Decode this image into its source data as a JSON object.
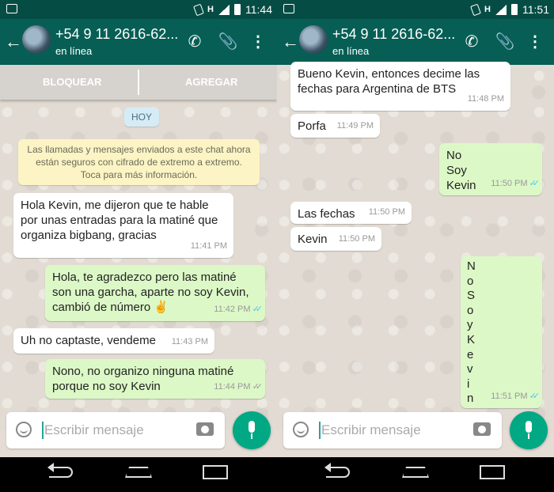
{
  "status": {
    "left_time": "11:44",
    "right_time": "11:51",
    "network": "H"
  },
  "contact": {
    "name": "+54 9 11 2616-62...",
    "status": "en línea"
  },
  "actions": {
    "block": "BLOQUEAR",
    "add": "AGREGAR"
  },
  "chip": "HOY",
  "notice": "Las llamadas y mensajes enviados a este chat ahora están seguros con cifrado de extremo a extremo. Toca para más información.",
  "left_messages": [
    {
      "dir": "in",
      "text": "Hola Kevin, me dijeron que te hable por unas entradas para la matiné que organiza bigbang, gracias",
      "time": "11:41 PM",
      "ticks": ""
    },
    {
      "dir": "out",
      "text": "Hola, te agradezco pero las matiné son una garcha, aparte no soy Kevin, cambió de número ✌",
      "time": "11:42 PM",
      "ticks": "read"
    },
    {
      "dir": "in",
      "text": "Uh no captaste, vendeme",
      "time": "11:43 PM",
      "ticks": ""
    },
    {
      "dir": "out",
      "text": "Nono, no organizo ninguna matiné porque no soy Kevin",
      "time": "11:44 PM",
      "ticks": "delivered"
    }
  ],
  "right_messages": [
    {
      "dir": "in",
      "text": "Bueno Kevin, entonces decime las fechas para Argentina de BTS",
      "time": "11:48 PM",
      "ticks": ""
    },
    {
      "dir": "in",
      "text": "Porfa",
      "time": "11:49 PM",
      "ticks": ""
    },
    {
      "dir": "out",
      "text": "No Soy Kevin",
      "time": "11:50 PM",
      "ticks": "read"
    },
    {
      "dir": "in",
      "text": "Las fechas",
      "time": "11:50 PM",
      "ticks": ""
    },
    {
      "dir": "in",
      "text": "Kevin",
      "time": "11:50 PM",
      "ticks": ""
    },
    {
      "dir": "out",
      "text": "N o S o y K e v i n",
      "time": "11:51 PM",
      "ticks": "read"
    }
  ],
  "input": {
    "placeholder": "Escribir mensaje"
  },
  "icons": {
    "back": "arrow-left-icon",
    "call": "phone-icon",
    "attach": "paperclip-icon",
    "menu": "more-vert-icon",
    "emoji": "emoji-icon",
    "camera": "camera-icon",
    "mic": "mic-icon",
    "nav": [
      "nav-back-icon",
      "nav-home-icon",
      "nav-recent-icon"
    ]
  },
  "colors": {
    "header": "#075e54",
    "statusbar": "#054d44",
    "outgoing": "#dcf8c6",
    "incoming": "#ffffff",
    "accent": "#00a884",
    "read_ticks": "#4fc3f7"
  }
}
